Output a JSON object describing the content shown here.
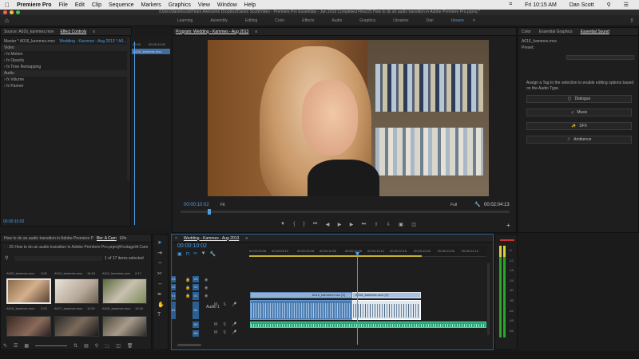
{
  "menubar": {
    "apple": "",
    "app": "Premiere Pro",
    "items": [
      "File",
      "Edit",
      "Clip",
      "Sequence",
      "Markers",
      "Graphics",
      "View",
      "Window",
      "Help"
    ],
    "clock": "Fri 10:15 AM",
    "user": "Dan Scott"
  },
  "titlebar": {
    "path": "/Users/danielscott/Team Awesome Dropbox/Daniel Scott/Video - Premiere Pro Essentials - Jan 2019 Completed Files/25 How to do an audio transition in Adobe Premiere Pro.prproj *"
  },
  "workspaces": {
    "items": [
      "Learning",
      "Assembly",
      "Editing",
      "Color",
      "Effects",
      "Audio",
      "Graphics",
      "Libraries",
      "Dan",
      "Unsure"
    ],
    "active": "Unsure"
  },
  "source": {
    "tab1": "Source: A016_kammes.mov",
    "tab2": "Effect Controls",
    "master": "Master * A016_kammes.mov",
    "sequence": "Wedding - Kammes - Aug 2013 * A0...",
    "time_start": "00:00",
    "time_end": "00:00:11:00",
    "clip_label": "A016_kammes.mov",
    "video_header": "Video",
    "rows": [
      "Motion",
      "Opacity",
      "Time Remapping"
    ],
    "audio_header": "Audio",
    "audio_rows": [
      "Volume",
      "Panner"
    ],
    "timecode": "00:00:10:02"
  },
  "program": {
    "title": "Program: Wedding - Kammes - Aug 2013",
    "timecode": "00:00:10:02",
    "fit": "Fit",
    "full": "Full",
    "duration": "00:02:04:13"
  },
  "essential_sound": {
    "tabs": [
      "Color",
      "Essential Graphics",
      "Essential Sound"
    ],
    "clip": "A016_kammes.mov",
    "preset_label": "Preset:",
    "hint": "Assign a Tag to the selection to enable editing options based on the Audio Type.",
    "buttons": [
      "Dialogue",
      "Music",
      "SFX",
      "Ambience"
    ]
  },
  "project": {
    "tab1": "How to do an audio transition in Adobe Premiere Pro",
    "tab2": "Bin: A Cam",
    "tab3": "Effe",
    "path": "25 How to do an audio transition in Adobe Premiere Pro.prproj\\Footage\\A Cam",
    "selected": "1 of 17 items selected",
    "top_clips": [
      {
        "name": "A009_kammes.mov",
        "dur": "3:00"
      },
      {
        "name": "A010_kammes.mov",
        "dur": "16:18"
      },
      {
        "name": "A011_kammes.mov",
        "dur": "2:17"
      }
    ],
    "clips": [
      {
        "name": "A016_kammes.mov",
        "dur": "2:03"
      },
      {
        "name": "A017_kammes.mov",
        "dur": "11:00"
      },
      {
        "name": "A018_kammes.mov",
        "dur": "10:16"
      }
    ]
  },
  "timeline": {
    "tab": "Wedding - Kammes - Aug 2013",
    "timecode": "00:00:10:02",
    "ruler": [
      "00:00:09:06",
      "00:00:09:12",
      "00:00:09:18",
      "00:00:10:00",
      "00:00:10:06",
      "00:00:10:12",
      "00:00:10:18",
      "00:00:11:00",
      "00:00:11:06",
      "00:00:11:12",
      "00:00:12:00",
      "00:00:12:06",
      "00:00:12:12"
    ],
    "tracks": {
      "v3": "V3",
      "v2": "V2",
      "v1": "V1",
      "a1": "A1",
      "a2": "A2",
      "a3": "A3"
    },
    "audio_label": "Audio 1",
    "clip1": "A016_kammes.mov [V]",
    "clip2": "A016_kammes.mov [V]"
  },
  "meter": {
    "scale": [
      "-6",
      "-12",
      "-18",
      "-24",
      "-30",
      "-36",
      "-42",
      "-48",
      "-54"
    ]
  },
  "colors": {
    "accent": "#4a9fe8",
    "clip_blue": "#8fb1d8",
    "audio_green": "#2fa37a"
  }
}
